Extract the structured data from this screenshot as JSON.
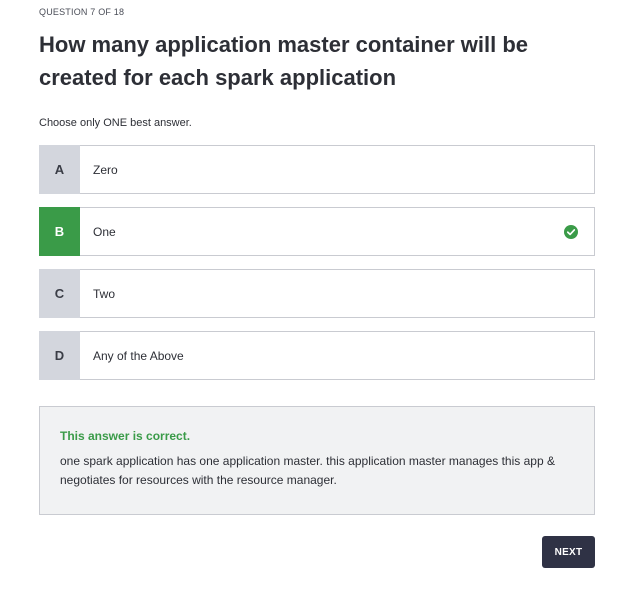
{
  "question": {
    "counter": "QUESTION 7 OF 18",
    "title": "How many application master container will be created for each spark application",
    "instructions": "Choose only ONE best answer."
  },
  "options": [
    {
      "letter": "A",
      "text": "Zero",
      "selected": false
    },
    {
      "letter": "B",
      "text": "One",
      "selected": true,
      "status_icon": "check-circle-icon"
    },
    {
      "letter": "C",
      "text": "Two",
      "selected": false
    },
    {
      "letter": "D",
      "text": "Any of the Above",
      "selected": false
    }
  ],
  "feedback": {
    "title": "This answer is correct.",
    "body": "one spark application has one application master. this application master manages this app & negotiates for resources with the resource manager."
  },
  "actions": {
    "next_label": "NEXT"
  },
  "colors": {
    "correct": "#3a9b48",
    "letter_bg": "#d3d6dd",
    "button_bg": "#2f3245",
    "feedback_bg": "#f1f2f3"
  }
}
